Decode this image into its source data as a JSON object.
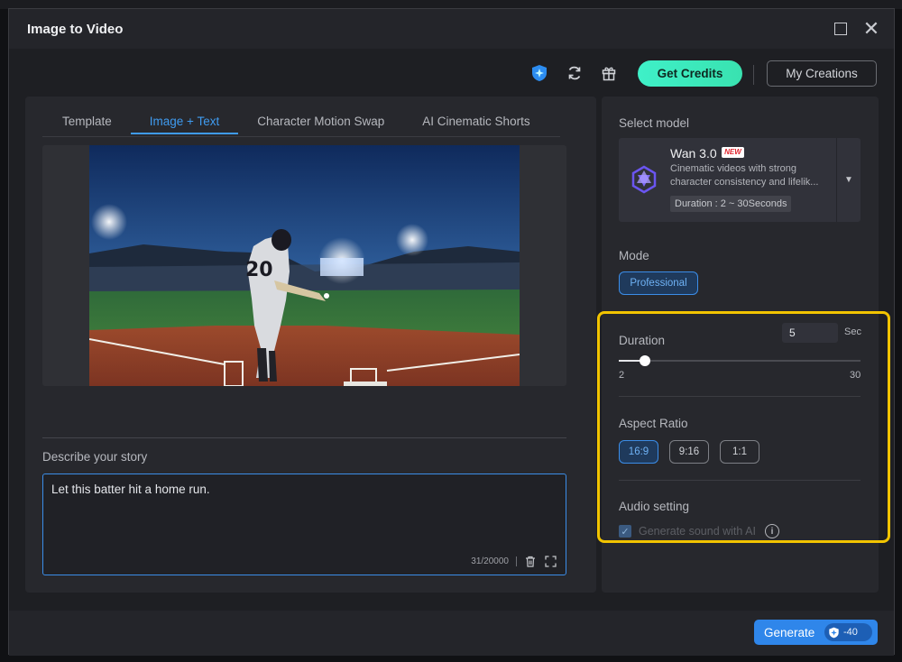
{
  "window": {
    "title": "Image to Video"
  },
  "toolbar": {
    "get_credits_label": "Get Credits",
    "my_creations_label": "My Creations"
  },
  "tabs": [
    {
      "label": "Template",
      "active": false
    },
    {
      "label": "Image + Text",
      "active": true
    },
    {
      "label": "Character Motion Swap",
      "active": false
    },
    {
      "label": "AI Cinematic Shorts",
      "active": false
    }
  ],
  "preview": {
    "jersey_number": "20"
  },
  "story": {
    "label": "Describe your story",
    "text": "Let this batter hit a home run.",
    "char_count": "31/20000"
  },
  "model": {
    "section_label": "Select model",
    "name": "Wan 3.0",
    "badge": "NEW",
    "description": "Cinematic videos with strong character consistency and lifelik...",
    "duration_range": "Duration : 2 ~ 30Seconds"
  },
  "mode": {
    "label": "Mode",
    "selected": "Professional"
  },
  "duration": {
    "label": "Duration",
    "value": "5",
    "unit": "Sec",
    "min": 2,
    "max": 30,
    "current": 5,
    "min_label": "2",
    "max_label": "30"
  },
  "aspect_ratio": {
    "label": "Aspect Ratio",
    "options": [
      {
        "label": "16:9",
        "selected": true
      },
      {
        "label": "9:16",
        "selected": false
      },
      {
        "label": "1:1",
        "selected": false
      }
    ]
  },
  "audio": {
    "label": "Audio setting",
    "checkbox_label": "Generate sound with AI",
    "checked": true
  },
  "footer": {
    "generate_label": "Generate",
    "cost": "-40"
  },
  "colors": {
    "accent": "#2f86ea",
    "credits_gradient": "#3ff0c8",
    "highlight": "#f2c400"
  }
}
